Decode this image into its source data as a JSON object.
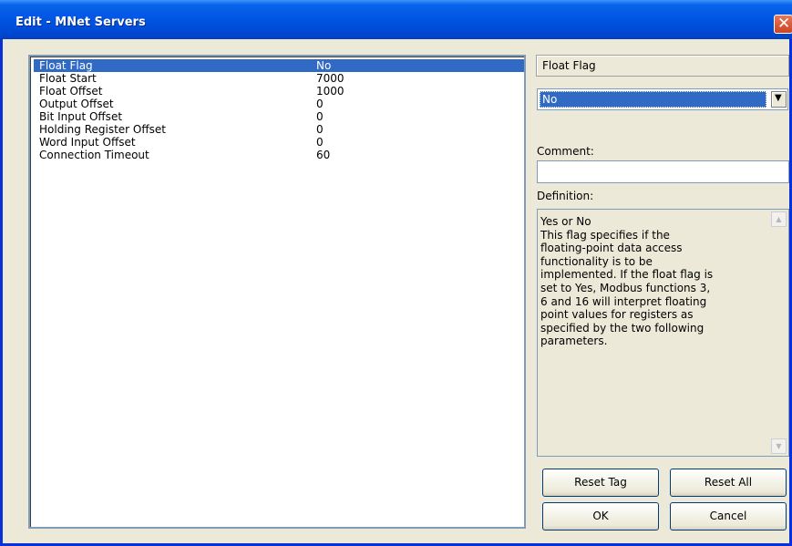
{
  "window": {
    "title": "Edit - MNet Servers"
  },
  "params": [
    {
      "name": "Float Flag",
      "value": "No"
    },
    {
      "name": "Float Start",
      "value": "7000"
    },
    {
      "name": "Float Offset",
      "value": "1000"
    },
    {
      "name": "Output Offset",
      "value": "0"
    },
    {
      "name": "Bit Input Offset",
      "value": "0"
    },
    {
      "name": "Holding Register Offset",
      "value": "0"
    },
    {
      "name": "Word Input Offset",
      "value": "0"
    },
    {
      "name": "Connection Timeout",
      "value": "60"
    }
  ],
  "selected_index": 0,
  "editor": {
    "field_name": "Float Flag",
    "combo_value": "No",
    "comment_label": "Comment:",
    "comment_value": "",
    "definition_label": "Definition:",
    "definition_text": "Yes or No\nThis flag specifies if the\nfloating-point data access\nfunctionality is to be\nimplemented. If the float flag is\nset to Yes, Modbus functions 3,\n6 and 16 will interpret floating\npoint values for registers as\nspecified by the two following\nparameters."
  },
  "buttons": {
    "reset_tag": "Reset Tag",
    "reset_all": "Reset All",
    "ok": "OK",
    "cancel": "Cancel"
  },
  "icons": {
    "close": "close-icon",
    "dropdown": "chevron-down-icon",
    "scroll_up": "scroll-up-icon",
    "scroll_down": "scroll-down-icon"
  }
}
